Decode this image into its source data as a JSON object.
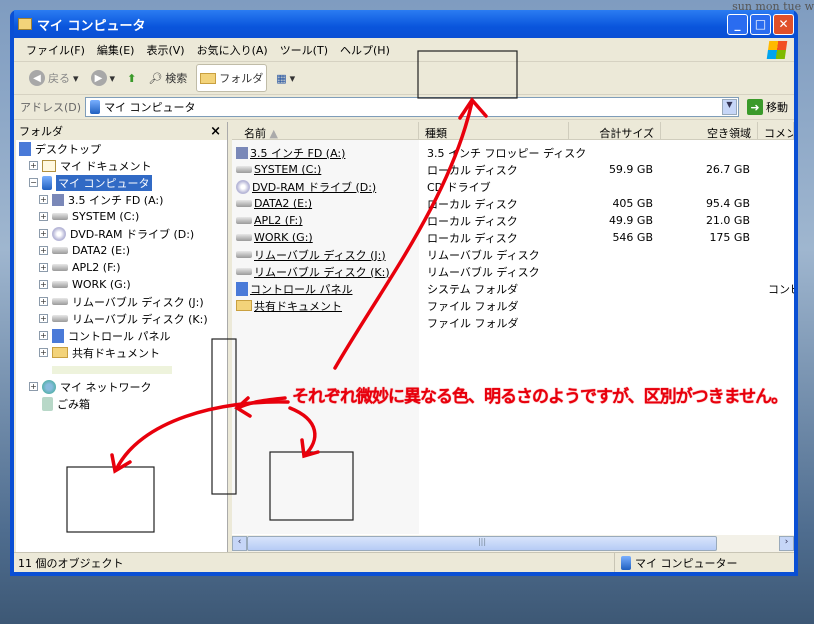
{
  "desktop_text": "sun  mon  tue  w",
  "window": {
    "title": "マイ コンピュータ"
  },
  "menu": [
    "ファイル(F)",
    "編集(E)",
    "表示(V)",
    "お気に入り(A)",
    "ツール(T)",
    "ヘルプ(H)"
  ],
  "toolbar": {
    "back": "戻る",
    "search": "検索",
    "folders": "フォルダ"
  },
  "address": {
    "label": "アドレス(D)",
    "value": "マイ コンピュータ",
    "go": "移動"
  },
  "folders_pane": {
    "title": "フォルダ",
    "close": "×",
    "tree": [
      {
        "label": "デスクトップ",
        "icon": "desktop",
        "level": 0,
        "expander": ""
      },
      {
        "label": "マイ ドキュメント",
        "icon": "doc",
        "level": 1,
        "expander": "+"
      },
      {
        "label": "マイ コンピュータ",
        "icon": "pc",
        "level": 1,
        "expander": "−",
        "selected": true
      },
      {
        "label": "3.5 インチ FD (A:)",
        "icon": "fd",
        "level": 2,
        "expander": "+"
      },
      {
        "label": "SYSTEM (C:)",
        "icon": "hdd",
        "level": 2,
        "expander": "+"
      },
      {
        "label": "DVD-RAM ドライブ (D:)",
        "icon": "cd",
        "level": 2,
        "expander": "+"
      },
      {
        "label": "DATA2 (E:)",
        "icon": "hdd",
        "level": 2,
        "expander": "+"
      },
      {
        "label": "APL2 (F:)",
        "icon": "hdd",
        "level": 2,
        "expander": "+"
      },
      {
        "label": "WORK (G:)",
        "icon": "hdd",
        "level": 2,
        "expander": "+"
      },
      {
        "label": "リムーバブル ディスク (J:)",
        "icon": "hdd",
        "level": 2,
        "expander": "+"
      },
      {
        "label": "リムーバブル ディスク (K:)",
        "icon": "hdd",
        "level": 2,
        "expander": "+"
      },
      {
        "label": "コントロール パネル",
        "icon": "cp",
        "level": 2,
        "expander": "+"
      },
      {
        "label": "共有ドキュメント",
        "icon": "fold",
        "level": 2,
        "expander": "+"
      },
      {
        "label": "",
        "icon": "",
        "level": 2,
        "expander": ""
      },
      {
        "label": "マイ ネットワーク",
        "icon": "net",
        "level": 1,
        "expander": "+"
      },
      {
        "label": "ごみ箱",
        "icon": "bin",
        "level": 1,
        "expander": ""
      }
    ]
  },
  "columns": [
    "名前",
    "種類",
    "合計サイズ",
    "空き領域",
    "コメント"
  ],
  "items": [
    {
      "name": "3.5 インチ FD (A:)",
      "type": "3.5 インチ フロッピー ディスク",
      "total": "",
      "free": "",
      "comment": "",
      "icon": "fd"
    },
    {
      "name": "SYSTEM (C:)",
      "type": "ローカル ディスク",
      "total": "59.9 GB",
      "free": "26.7 GB",
      "comment": "",
      "icon": "hdd"
    },
    {
      "name": "DVD-RAM ドライブ (D:)",
      "type": "CD ドライブ",
      "total": "",
      "free": "",
      "comment": "",
      "icon": "cd"
    },
    {
      "name": "DATA2 (E:)",
      "type": "ローカル ディスク",
      "total": "405 GB",
      "free": "95.4 GB",
      "comment": "",
      "icon": "hdd"
    },
    {
      "name": "APL2 (F:)",
      "type": "ローカル ディスク",
      "total": "49.9 GB",
      "free": "21.0 GB",
      "comment": "",
      "icon": "hdd"
    },
    {
      "name": "WORK (G:)",
      "type": "ローカル ディスク",
      "total": "546 GB",
      "free": "175 GB",
      "comment": "",
      "icon": "hdd"
    },
    {
      "name": "リムーバブル ディスク (J:)",
      "type": "リムーバブル ディスク",
      "total": "",
      "free": "",
      "comment": "",
      "icon": "hdd"
    },
    {
      "name": "リムーバブル ディスク (K:)",
      "type": "リムーバブル ディスク",
      "total": "",
      "free": "",
      "comment": "",
      "icon": "hdd"
    },
    {
      "name": "コントロール パネル",
      "type": "システム フォルダ",
      "total": "",
      "free": "",
      "comment": "コンピュ",
      "icon": "cp"
    },
    {
      "name": "共有ドキュメント",
      "type": "ファイル フォルダ",
      "total": "",
      "free": "",
      "comment": "",
      "icon": "fold"
    },
    {
      "name": "",
      "type": "ファイル フォルダ",
      "total": "",
      "free": "",
      "comment": "",
      "icon": ""
    }
  ],
  "status": {
    "count": "11 個のオブジェクト",
    "location": "マイ コンピューター"
  },
  "annotation": {
    "text": "それぞれ微妙に異なる色、明るさのようですが、区別がつきません。",
    "color": "#e8000c"
  }
}
